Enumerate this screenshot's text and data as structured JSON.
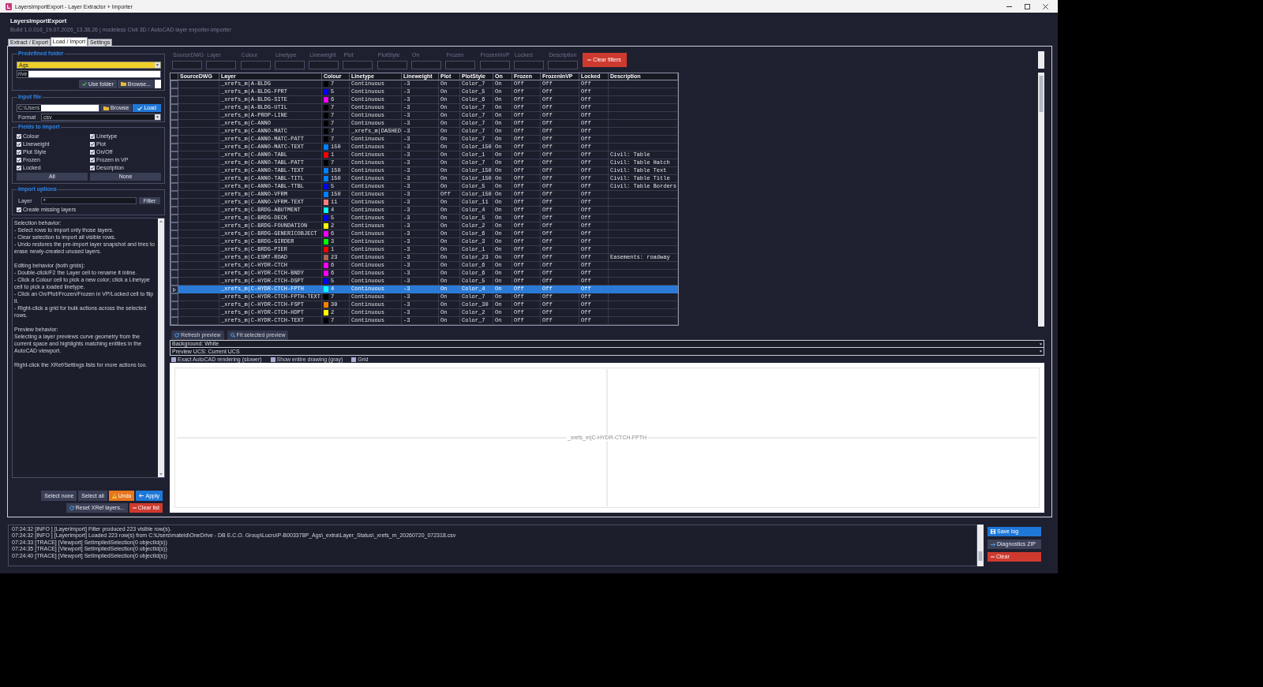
{
  "window": {
    "title": "LayersImportExport - Layer Extractor + Importer"
  },
  "header": {
    "app_name": "LayersImportExport",
    "build_info": "Build 1.0.016_19.07.2026_13.38.26 | modeless Civil 3D / AutoCAD layer exporter-importer"
  },
  "tabs": [
    {
      "label": "Extract / Export",
      "selected": false
    },
    {
      "label": "Load / Import",
      "selected": true
    },
    {
      "label": "Settings",
      "selected": false
    }
  ],
  "predefined_folder": {
    "title": "Predefined folder",
    "folder": "Ags",
    "path": "rive",
    "buttons": [
      {
        "label": "Use folder",
        "kind": "confirm"
      },
      {
        "label": "Browse...",
        "kind": "browse"
      }
    ]
  },
  "input_file": {
    "title": "Input file",
    "path": "C:\\Users",
    "buttons": [
      {
        "label": "Browse",
        "kind": "browse"
      },
      {
        "label": "Load",
        "kind": "load"
      }
    ],
    "format_label": "Format",
    "format": "csv"
  },
  "fields_to_import": {
    "title": "Fields to import",
    "fields": [
      {
        "label": "Colour",
        "checked": true
      },
      {
        "label": "Linetype",
        "checked": true
      },
      {
        "label": "Lineweight",
        "checked": true
      },
      {
        "label": "Plot",
        "checked": true
      },
      {
        "label": "Plot Style",
        "checked": true
      },
      {
        "label": "On/Off",
        "checked": true
      },
      {
        "label": "Frozen",
        "checked": true
      },
      {
        "label": "Frozen in VP",
        "checked": true
      },
      {
        "label": "Locked",
        "checked": true
      },
      {
        "label": "Description",
        "checked": true
      }
    ],
    "buttons": [
      {
        "label": "All",
        "kind": "plain"
      },
      {
        "label": "None",
        "kind": "plain"
      }
    ]
  },
  "import_options": {
    "title": "Import options",
    "layer_label": "Layer",
    "layer_filter": "*",
    "filter_button": {
      "label": "Filter",
      "kind": "plain"
    },
    "create_missing": {
      "label": "Create missing layers",
      "checked": true
    }
  },
  "help": [
    [
      "Selection behavior:",
      "- Select rows to import only those layers.",
      "- Clear selection to import all visible rows.",
      "- Undo restores the pre-import layer snapshot and tries to erase newly-created unused layers."
    ],
    [
      "Editing behavior (both grids):",
      "- Double-click/F2 the Layer cell to rename it inline.",
      "- Click a Colour cell to pick a new color; click a Linetype cell to pick a loaded linetype.",
      "- Click an On/Plot/Frozen/Frozen in VP/Locked cell to flip it.",
      "- Right-click a grid for bulk actions across the selected rows."
    ],
    [
      "Preview behavior:",
      "Selecting a layer previews curve geometry from the current space and highlights matching entities in the AutoCAD viewport."
    ],
    [
      "Right-click the XRef/Settings lists for more actions too."
    ]
  ],
  "action_rows": [
    [
      {
        "label": "Select none",
        "kind": "plain"
      },
      {
        "label": "Select all",
        "kind": "plain"
      },
      {
        "label": "Undo",
        "kind": "undo"
      },
      {
        "label": "Apply",
        "kind": "apply"
      }
    ],
    [
      {
        "label": "Reset XRef layers...",
        "kind": "reset"
      },
      {
        "label": "Clear list",
        "kind": "clear"
      }
    ]
  ],
  "filters": {
    "labels": [
      "SourceDWG",
      "Layer",
      "Colour",
      "Linetype",
      "Lineweight",
      "Plot",
      "PlotStyle",
      "On",
      "Frozen",
      "FrozenInVP",
      "Locked",
      "Description"
    ],
    "clear_button": {
      "label": "Clear filters",
      "kind": "clear"
    }
  },
  "grid": {
    "columns": [
      "SourceDWG",
      "Layer",
      "Colour",
      "Linetype",
      "Lineweight",
      "Plot",
      "PlotStyle",
      "On",
      "Frozen",
      "FrozenInVP",
      "Locked",
      "Description"
    ],
    "rows": [
      {
        "selected": false,
        "layer": "_xrefs_m|A-BLDG",
        "colour": "7",
        "color": "#000000",
        "linetype": "Continuous",
        "lineweight": "-3",
        "plot": "On",
        "plot_style": "Color_7",
        "on": "On",
        "frozen": "Off",
        "frozen_in_vp": "Off",
        "locked": "Off"
      },
      {
        "selected": false,
        "layer": "_xrefs_m|A-BLDG-FPRT",
        "colour": "5",
        "color": "#0000ff",
        "linetype": "Continuous",
        "lineweight": "-3",
        "plot": "On",
        "plot_style": "Color_5",
        "on": "On",
        "frozen": "Off",
        "frozen_in_vp": "Off",
        "locked": "Off"
      },
      {
        "selected": false,
        "layer": "_xrefs_m|A-BLDG-SITE",
        "colour": "6",
        "color": "#ff00ff",
        "linetype": "Continuous",
        "lineweight": "-3",
        "plot": "On",
        "plot_style": "Color_6",
        "on": "On",
        "frozen": "Off",
        "frozen_in_vp": "Off",
        "locked": "Off"
      },
      {
        "selected": false,
        "layer": "_xrefs_m|A-BLDG-UTIL",
        "colour": "7",
        "color": "#000000",
        "linetype": "Continuous",
        "lineweight": "-3",
        "plot": "On",
        "plot_style": "Color_7",
        "on": "On",
        "frozen": "Off",
        "frozen_in_vp": "Off",
        "locked": "Off"
      },
      {
        "selected": false,
        "layer": "_xrefs_m|A-PROP-LINE",
        "colour": "7",
        "color": "#000000",
        "linetype": "Continuous",
        "lineweight": "-3",
        "plot": "On",
        "plot_style": "Color_7",
        "on": "On",
        "frozen": "Off",
        "frozen_in_vp": "Off",
        "locked": "Off"
      },
      {
        "selected": false,
        "layer": "_xrefs_m|C-ANNO",
        "colour": "7",
        "color": "#000000",
        "linetype": "Continuous",
        "lineweight": "-3",
        "plot": "On",
        "plot_style": "Color_7",
        "on": "On",
        "frozen": "Off",
        "frozen_in_vp": "Off",
        "locked": "Off"
      },
      {
        "selected": false,
        "layer": "_xrefs_m|C-ANNO-MATC",
        "colour": "7",
        "color": "#000000",
        "linetype": "_xrefs_m|DASHED",
        "lineweight": "-3",
        "plot": "On",
        "plot_style": "Color_7",
        "on": "On",
        "frozen": "Off",
        "frozen_in_vp": "Off",
        "locked": "Off"
      },
      {
        "selected": false,
        "layer": "_xrefs_m|C-ANNO-MATC-PATT",
        "colour": "7",
        "color": "#000000",
        "linetype": "Continuous",
        "lineweight": "-3",
        "plot": "On",
        "plot_style": "Color_7",
        "on": "On",
        "frozen": "Off",
        "frozen_in_vp": "Off",
        "locked": "Off"
      },
      {
        "selected": false,
        "layer": "_xrefs_m|C-ANNO-MATC-TEXT",
        "colour": "150",
        "color": "#007fff",
        "linetype": "Continuous",
        "lineweight": "-3",
        "plot": "On",
        "plot_style": "Color_150",
        "on": "On",
        "frozen": "Off",
        "frozen_in_vp": "Off",
        "locked": "Off"
      },
      {
        "selected": false,
        "layer": "_xrefs_m|C-ANNO-TABL",
        "colour": "1",
        "color": "#ff0000",
        "linetype": "Continuous",
        "lineweight": "-3",
        "plot": "On",
        "plot_style": "Color_1",
        "on": "On",
        "frozen": "Off",
        "frozen_in_vp": "Off",
        "locked": "Off",
        "description": "Civil: Table"
      },
      {
        "selected": false,
        "layer": "_xrefs_m|C-ANNO-TABL-PATT",
        "colour": "7",
        "color": "#000000",
        "linetype": "Continuous",
        "lineweight": "-3",
        "plot": "On",
        "plot_style": "Color_7",
        "on": "On",
        "frozen": "Off",
        "frozen_in_vp": "Off",
        "locked": "Off",
        "description": "Civil: Table Hatch"
      },
      {
        "selected": false,
        "layer": "_xrefs_m|C-ANNO-TABL-TEXT",
        "colour": "150",
        "color": "#007fff",
        "linetype": "Continuous",
        "lineweight": "-3",
        "plot": "On",
        "plot_style": "Color_150",
        "on": "On",
        "frozen": "Off",
        "frozen_in_vp": "Off",
        "locked": "Off",
        "description": "Civil: Table Text"
      },
      {
        "selected": false,
        "layer": "_xrefs_m|C-ANNO-TABL-TITL",
        "colour": "150",
        "color": "#007fff",
        "linetype": "Continuous",
        "lineweight": "-3",
        "plot": "On",
        "plot_style": "Color_150",
        "on": "On",
        "frozen": "Off",
        "frozen_in_vp": "Off",
        "locked": "Off",
        "description": "Civil: Table Title"
      },
      {
        "selected": false,
        "layer": "_xrefs_m|C-ANNO-TABL-TTBL",
        "colour": "5",
        "color": "#0000ff",
        "linetype": "Continuous",
        "lineweight": "-3",
        "plot": "On",
        "plot_style": "Color_5",
        "on": "On",
        "frozen": "Off",
        "frozen_in_vp": "Off",
        "locked": "Off",
        "description": "Civil: Table Borders"
      },
      {
        "selected": false,
        "layer": "_xrefs_m|C-ANNO-VFRM",
        "colour": "150",
        "color": "#007fff",
        "linetype": "Continuous",
        "lineweight": "-3",
        "plot": "Off",
        "plot_style": "Color_150",
        "on": "On",
        "frozen": "Off",
        "frozen_in_vp": "Off",
        "locked": "Off"
      },
      {
        "selected": false,
        "layer": "_xrefs_m|C-ANNO-VFRM-TEXT",
        "colour": "11",
        "color": "#ff7f7f",
        "linetype": "Continuous",
        "lineweight": "-3",
        "plot": "On",
        "plot_style": "Color_11",
        "on": "On",
        "frozen": "Off",
        "frozen_in_vp": "Off",
        "locked": "Off"
      },
      {
        "selected": false,
        "layer": "_xrefs_m|C-BRDG-ABUTMENT",
        "colour": "4",
        "color": "#00ffff",
        "linetype": "Continuous",
        "lineweight": "-3",
        "plot": "On",
        "plot_style": "Color_4",
        "on": "On",
        "frozen": "Off",
        "frozen_in_vp": "Off",
        "locked": "Off"
      },
      {
        "selected": false,
        "layer": "_xrefs_m|C-BRDG-DECK",
        "colour": "5",
        "color": "#0000ff",
        "linetype": "Continuous",
        "lineweight": "-3",
        "plot": "On",
        "plot_style": "Color_5",
        "on": "On",
        "frozen": "Off",
        "frozen_in_vp": "Off",
        "locked": "Off"
      },
      {
        "selected": false,
        "layer": "_xrefs_m|C-BRDG-FOUNDATION",
        "colour": "2",
        "color": "#ffff00",
        "linetype": "Continuous",
        "lineweight": "-3",
        "plot": "On",
        "plot_style": "Color_2",
        "on": "On",
        "frozen": "Off",
        "frozen_in_vp": "Off",
        "locked": "Off"
      },
      {
        "selected": false,
        "layer": "_xrefs_m|C-BRDG-GENERICOBJECT",
        "colour": "6",
        "color": "#ff00ff",
        "linetype": "Continuous",
        "lineweight": "-3",
        "plot": "On",
        "plot_style": "Color_6",
        "on": "On",
        "frozen": "Off",
        "frozen_in_vp": "Off",
        "locked": "Off"
      },
      {
        "selected": false,
        "layer": "_xrefs_m|C-BRDG-GIRDER",
        "colour": "3",
        "color": "#00ff00",
        "linetype": "Continuous",
        "lineweight": "-3",
        "plot": "On",
        "plot_style": "Color_3",
        "on": "On",
        "frozen": "Off",
        "frozen_in_vp": "Off",
        "locked": "Off"
      },
      {
        "selected": false,
        "layer": "_xrefs_m|C-BRDG-PIER",
        "colour": "1",
        "color": "#ff0000",
        "linetype": "Continuous",
        "lineweight": "-3",
        "plot": "On",
        "plot_style": "Color_1",
        "on": "On",
        "frozen": "Off",
        "frozen_in_vp": "Off",
        "locked": "Off"
      },
      {
        "selected": false,
        "layer": "_xrefs_m|C-ESMT-ROAD",
        "colour": "23",
        "color": "#a56752",
        "linetype": "Continuous",
        "lineweight": "-3",
        "plot": "On",
        "plot_style": "Color_23",
        "on": "On",
        "frozen": "Off",
        "frozen_in_vp": "Off",
        "locked": "Off",
        "description": "Easements: roadway"
      },
      {
        "selected": false,
        "layer": "_xrefs_m|C-HYDR-CTCH",
        "colour": "6",
        "color": "#ff00ff",
        "linetype": "Continuous",
        "lineweight": "-3",
        "plot": "On",
        "plot_style": "Color_6",
        "on": "On",
        "frozen": "Off",
        "frozen_in_vp": "Off",
        "locked": "Off"
      },
      {
        "selected": false,
        "layer": "_xrefs_m|C-HYDR-CTCH-BNDY",
        "colour": "6",
        "color": "#ff00ff",
        "linetype": "Continuous",
        "lineweight": "-3",
        "plot": "On",
        "plot_style": "Color_6",
        "on": "On",
        "frozen": "Off",
        "frozen_in_vp": "Off",
        "locked": "Off"
      },
      {
        "selected": false,
        "layer": "_xrefs_m|C-HYDR-CTCH-DSPT",
        "colour": "5",
        "color": "#0000ff",
        "linetype": "Continuous",
        "lineweight": "-3",
        "plot": "On",
        "plot_style": "Color_5",
        "on": "On",
        "frozen": "Off",
        "frozen_in_vp": "Off",
        "locked": "Off"
      },
      {
        "selected": true,
        "layer": "_xrefs_m|C-HYDR-CTCH-FPTH",
        "colour": "4",
        "color": "#00ffff",
        "linetype": "Continuous",
        "lineweight": "-3",
        "plot": "On",
        "plot_style": "Color_4",
        "on": "On",
        "frozen": "Off",
        "frozen_in_vp": "Off",
        "locked": "Off"
      },
      {
        "selected": false,
        "layer": "_xrefs_m|C-HYDR-CTCH-FPTH-TEXT",
        "colour": "7",
        "color": "#000000",
        "linetype": "Continuous",
        "lineweight": "-3",
        "plot": "On",
        "plot_style": "Color_7",
        "on": "On",
        "frozen": "Off",
        "frozen_in_vp": "Off",
        "locked": "Off"
      },
      {
        "selected": false,
        "layer": "_xrefs_m|C-HYDR-CTCH-FSPT",
        "colour": "30",
        "color": "#ff7f00",
        "linetype": "Continuous",
        "lineweight": "-3",
        "plot": "On",
        "plot_style": "Color_30",
        "on": "On",
        "frozen": "Off",
        "frozen_in_vp": "Off",
        "locked": "Off"
      },
      {
        "selected": false,
        "layer": "_xrefs_m|C-HYDR-CTCH-HDPT",
        "colour": "2",
        "color": "#ffff00",
        "linetype": "Continuous",
        "lineweight": "-3",
        "plot": "On",
        "plot_style": "Color_2",
        "on": "On",
        "frozen": "Off",
        "frozen_in_vp": "Off",
        "locked": "Off"
      },
      {
        "selected": false,
        "layer": "_xrefs_m|C-HYDR-CTCH-TEXT",
        "colour": "7",
        "color": "#000000",
        "linetype": "Continuous",
        "lineweight": "-3",
        "plot": "On",
        "plot_style": "Color_7",
        "on": "On",
        "frozen": "Off",
        "frozen_in_vp": "Off",
        "locked": "Off"
      }
    ]
  },
  "preview": {
    "buttons": [
      {
        "label": "Refresh preview",
        "kind": "refresh"
      },
      {
        "label": "Fit selected preview",
        "kind": "fit"
      }
    ],
    "selectors": [
      "Background: White",
      "Preview UCS: Current UCS"
    ],
    "options": [
      {
        "label": "Exact AutoCAD rendering (slower)",
        "checked": false
      },
      {
        "label": "Show entire drawing (gray)",
        "checked": false
      },
      {
        "label": "Grid",
        "checked": false
      }
    ],
    "layer_label": "_xrefs_m|C-HYDR-CTCH-FPTH"
  },
  "log": {
    "lines": [
      "07:24:32 [INFO ] [LayerImport] Filter produced 223 visible row(s).",
      "07:24:32 [INFO ] [LayerImport] Loaded 223 row(s) from C:\\Users\\mateid\\OneDrive - DB E.C.O. Group\\Lucru\\P-B003378P_Ags\\_extra\\Layer_Status\\_xrefs_m_20260720_072318.csv",
      "07:24:33 [TRACE] [Viewport] SetImpliedSelection(0 objectId(s))",
      "07:24:35 [TRACE] [Viewport] SetImpliedSelection(0 objectId(s))",
      "07:24:40 [TRACE] [Viewport] SetImpliedSelection(0 objectId(s))"
    ],
    "buttons": [
      {
        "label": "Save log",
        "kind": "save"
      },
      {
        "label": "Diagnostics ZIP",
        "kind": "export"
      },
      {
        "label": "Clear",
        "kind": "clear"
      }
    ]
  }
}
